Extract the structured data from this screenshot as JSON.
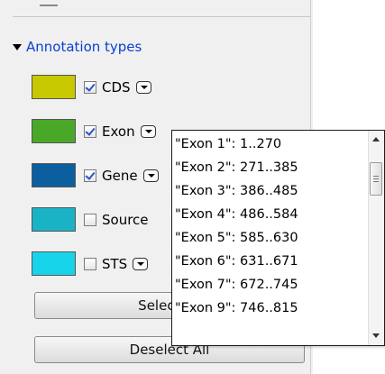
{
  "section": {
    "title": "Annotation types"
  },
  "annotation_types": [
    {
      "label": "CDS",
      "color": "#c8c800",
      "checked": true,
      "dropdown": true
    },
    {
      "label": "Exon",
      "color": "#4aa829",
      "checked": true,
      "dropdown": true
    },
    {
      "label": "Gene",
      "color": "#0b5f9e",
      "checked": true,
      "dropdown": true
    },
    {
      "label": "Source",
      "color": "#1ab3c6",
      "checked": false,
      "dropdown": false
    },
    {
      "label": "STS",
      "color": "#18d4ea",
      "checked": false,
      "dropdown": true
    }
  ],
  "buttons": {
    "select_all": "Select All",
    "deselect_all": "Deselect All"
  },
  "exon_popup": {
    "items": [
      "\"Exon 1\": 1..270",
      "\"Exon 2\": 271..385",
      "\"Exon 3\": 386..485",
      "\"Exon 4\": 486..584",
      "\"Exon 5\": 585..630",
      "\"Exon 6\": 631..671",
      "\"Exon 7\": 672..745",
      "\"Exon 9\": 746..815"
    ]
  }
}
